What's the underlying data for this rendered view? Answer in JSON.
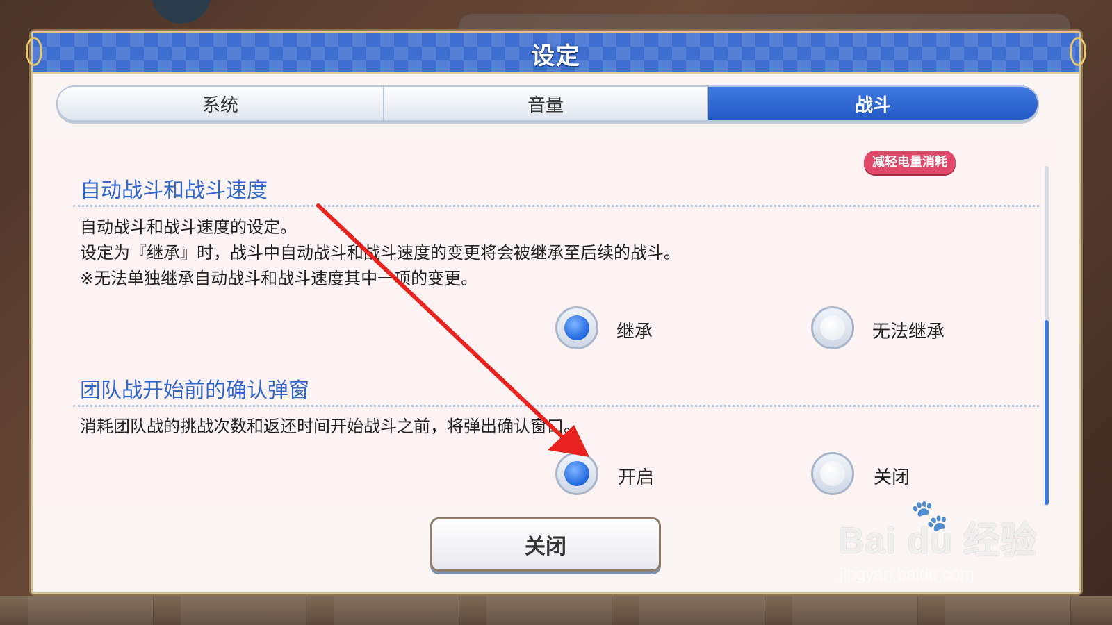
{
  "dialog": {
    "title": "设定",
    "tabs": [
      {
        "label": "系统",
        "active": false
      },
      {
        "label": "音量",
        "active": false
      },
      {
        "label": "战斗",
        "active": true
      }
    ],
    "badge": "减轻电量消耗",
    "sections": [
      {
        "title": "自动战斗和战斗速度",
        "description": [
          "自动战斗和战斗速度的设定。",
          "设定为『继承』时，战斗中自动战斗和战斗速度的变更将会被继承至后续的战斗。",
          "※无法单独继承自动战斗和战斗速度其中一项的变更。"
        ],
        "options": [
          {
            "label": "继承",
            "selected": true
          },
          {
            "label": "无法继承",
            "selected": false
          }
        ]
      },
      {
        "title": "团队战开始前的确认弹窗",
        "description": [
          "消耗团队战的挑战次数和返还时间开始战斗之前，将弹出确认窗口。"
        ],
        "options": [
          {
            "label": "开启",
            "selected": true
          },
          {
            "label": "关闭",
            "selected": false
          }
        ]
      }
    ],
    "close_label": "关闭"
  },
  "watermark": {
    "brand": "Bai du 经验",
    "url": "jingyan.baidu.com"
  },
  "colors": {
    "accent_blue": "#2f66c9",
    "badge_pink": "#e2486a",
    "annotation_red": "#e8231f"
  },
  "icons": {
    "annotation": "arrow-icon",
    "watermark": "paw-icon"
  }
}
